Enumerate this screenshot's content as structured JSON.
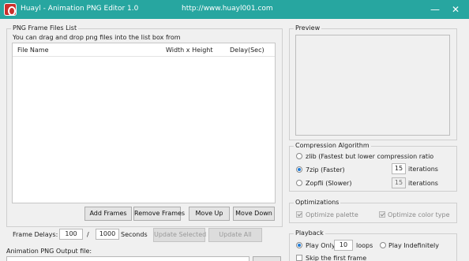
{
  "window": {
    "title": "Huayl - Animation PNG Editor 1.0",
    "url": "http://www.huayl001.com",
    "controls": {
      "minimize": "—",
      "close": "✕"
    }
  },
  "frames_list": {
    "group_title": "PNG Frame Files List",
    "hint": "You can drag and drop png files into the list box from",
    "columns": [
      "File Name",
      "Width x Height",
      "Delay(Sec)"
    ],
    "rows": [],
    "buttons": {
      "add": "Add Frames",
      "remove": "Remove Frames",
      "move_up": "Move Up",
      "move_down": "Move Down"
    }
  },
  "delays": {
    "label": "Frame Delays:",
    "numerator": "100",
    "separator": "/",
    "denominator": "1000",
    "unit": "Seconds",
    "update_selected": "Update Selected",
    "update_all": "Update All"
  },
  "output": {
    "label": "Animation PNG Output file:"
  },
  "preview": {
    "group_title": "Preview"
  },
  "compression": {
    "group_title": "Compression Algorithm",
    "options": [
      {
        "label": "zlib (Fastest but lower compression ratio",
        "checked": false,
        "iterations": ""
      },
      {
        "label": "7zip (Faster)",
        "checked": true,
        "iterations": "15"
      },
      {
        "label": "Zopfli (Slower)",
        "checked": false,
        "iterations": "15"
      }
    ],
    "iterations_label": "iterations"
  },
  "optimizations": {
    "group_title": "Optimizations",
    "optimize_palette": {
      "label": "Optimize palette",
      "checked": true
    },
    "optimize_color_type": {
      "label": "Optimize color type",
      "checked": true
    }
  },
  "playback": {
    "group_title": "Playback",
    "play_only": "Play Only",
    "loops_value": "10",
    "loops_label": "loops",
    "play_indefinitely": "Play Indefinitely",
    "play_only_checked": true,
    "skip_first_frame": "Skip the first frame"
  },
  "colors": {
    "titlebar": "#27a6a0",
    "window_bg": "#f0f0f0",
    "radio_accent": "#1f7bd6"
  }
}
